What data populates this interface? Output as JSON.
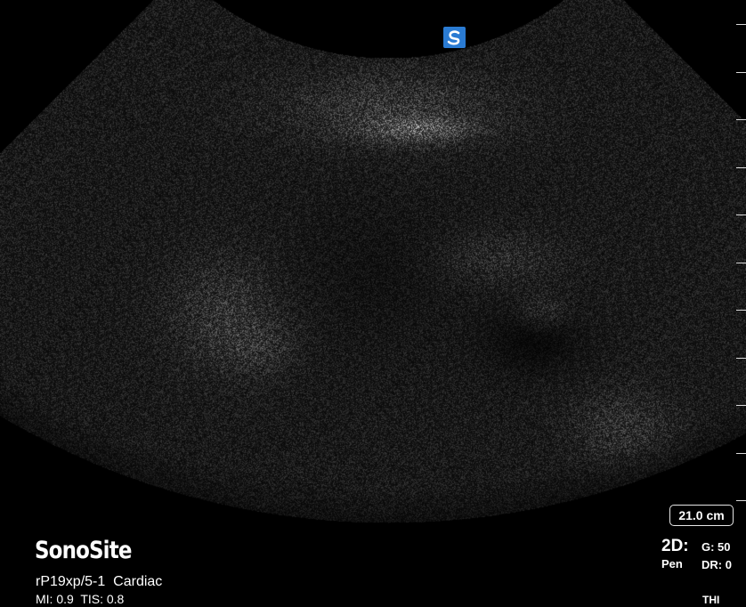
{
  "brand": "SonoSite",
  "probe_line": "rP19xp/5-1  Cardiac",
  "indices_line": "MI: 0.9  TIS: 0.8",
  "depth": "21.0 cm",
  "mode": {
    "label": "2D:",
    "submode": "Pen",
    "gain": "G: 50",
    "dynamic_range": "DR: 0",
    "harmonics": "THI"
  },
  "orientation_marker_icon": "sonosite-orientation-logo-icon",
  "colors": {
    "background": "#000000",
    "text": "#ffffff",
    "marker_blue": "#2a7bd3"
  }
}
